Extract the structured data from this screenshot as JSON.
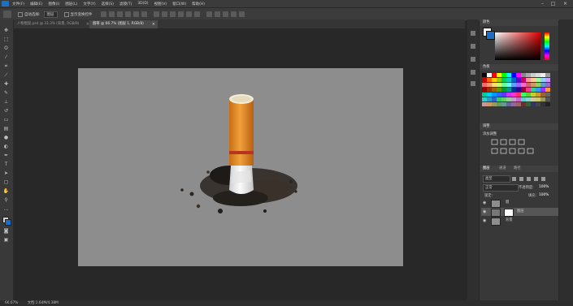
{
  "app": {
    "name": "Photoshop"
  },
  "menu": [
    "文件(F)",
    "编辑(E)",
    "图像(I)",
    "图层(L)",
    "文字(Y)",
    "选择(S)",
    "滤镜(T)",
    "3D(D)",
    "视图(V)",
    "窗口(W)",
    "帮助(H)"
  ],
  "options": {
    "auto_select_label": "自动选择:",
    "auto_select_value": "图层",
    "show_transform_label": "显示变换控件"
  },
  "tabs": [
    {
      "label": "人物图案.psd @ 33.3% (背景, RGB/8)",
      "active": false
    },
    {
      "label": "烟蒂 @ 66.7% (图层 1, RGB/8)",
      "active": true
    }
  ],
  "panels": {
    "color_title": "颜色",
    "swatches_title": "色板",
    "adjustments_title": "调整",
    "adjustments_sub": "添加调整",
    "layers_tabs": [
      "图层",
      "通道",
      "路径"
    ],
    "kind_label": "类型",
    "blend_mode": "正常",
    "opacity_label": "不透明度:",
    "opacity_value": "100%",
    "lock_label": "锁定:",
    "fill_label": "填充:",
    "fill_value": "100%"
  },
  "layers": [
    {
      "name": "烟",
      "visible": true,
      "selected": false
    },
    {
      "name": "图层",
      "visible": true,
      "selected": true
    },
    {
      "name": "背景",
      "visible": true,
      "selected": false
    }
  ],
  "status": {
    "zoom": "66.67%",
    "doc_info": "文档:1.64M/4.38M"
  },
  "colors": {
    "canvas_gray": "#8d8d8d",
    "filter_orange": "#e8902a",
    "paper_white": "#f2f2f2",
    "red_band": "#b8341e",
    "ash": "#2b2520"
  }
}
